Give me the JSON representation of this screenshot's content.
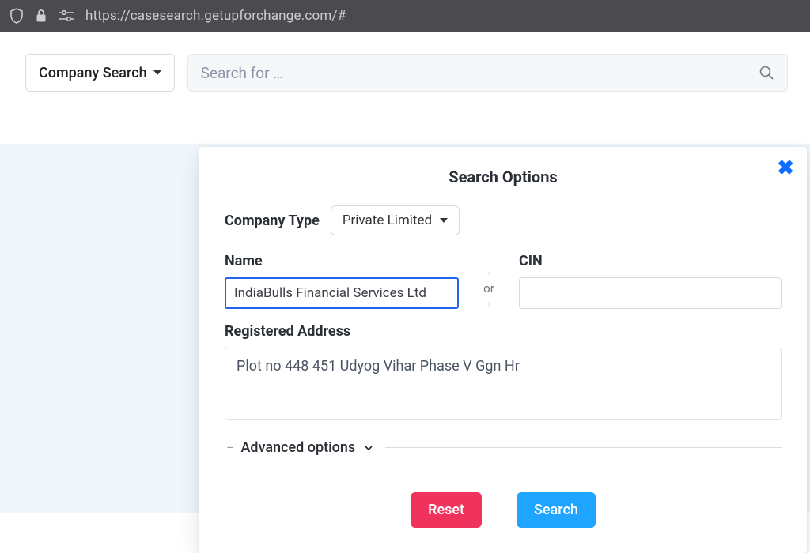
{
  "browser": {
    "url": "https://casesearch.getupforchange.com/#"
  },
  "toolbar": {
    "companySearchLabel": "Company Search",
    "searchPlaceholder": "Search for …"
  },
  "panel": {
    "title": "Search Options",
    "companyTypeLabel": "Company Type",
    "companyTypeValue": "Private Limited",
    "nameLabel": "Name",
    "nameValue": "IndiaBulls Financial Services Ltd",
    "orLabel": "or",
    "cinLabel": "CIN",
    "cinValue": "",
    "registeredAddressLabel": "Registered Address",
    "registeredAddressValue": "Plot no 448 451 Udyog Vihar Phase V Ggn Hr",
    "advancedOptionsLabel": "Advanced options",
    "resetLabel": "Reset",
    "searchLabel": "Search"
  }
}
